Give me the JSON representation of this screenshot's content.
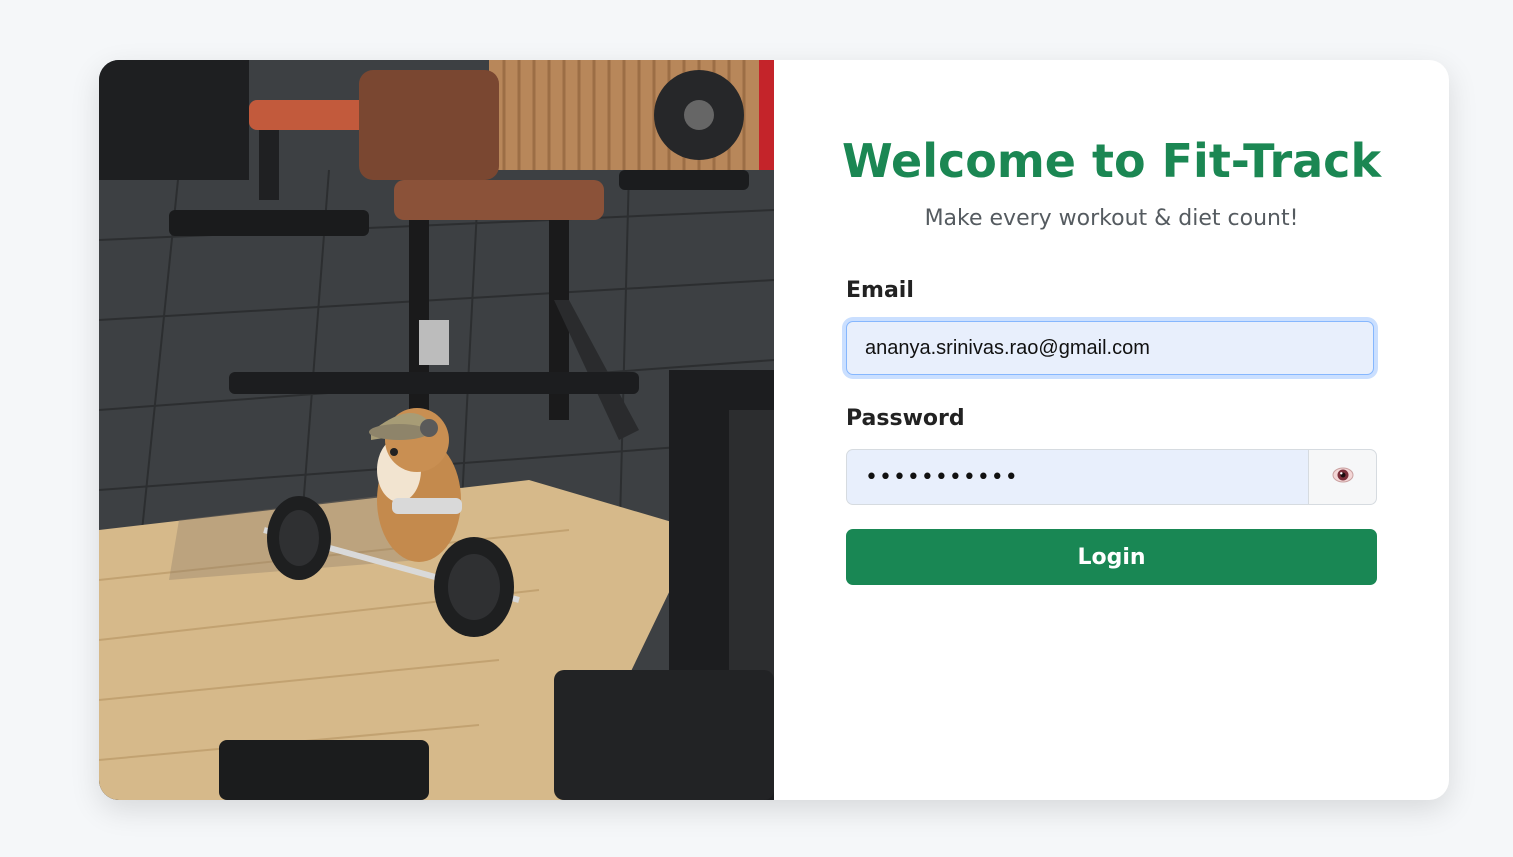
{
  "hero": {
    "description_icon": "gym-hamster-photo"
  },
  "form": {
    "title": "Welcome to Fit-Track",
    "subtitle": "Make every workout & diet count!",
    "email_label": "Email",
    "email_value": "ananya.srinivas.rao@gmail.com",
    "password_label": "Password",
    "password_value": "•••••••••••",
    "toggle_icon": "eye-icon",
    "login_label": "Login"
  },
  "colors": {
    "brand_green": "#198754",
    "title_green": "#1b8753",
    "input_bg": "#e8effc"
  }
}
